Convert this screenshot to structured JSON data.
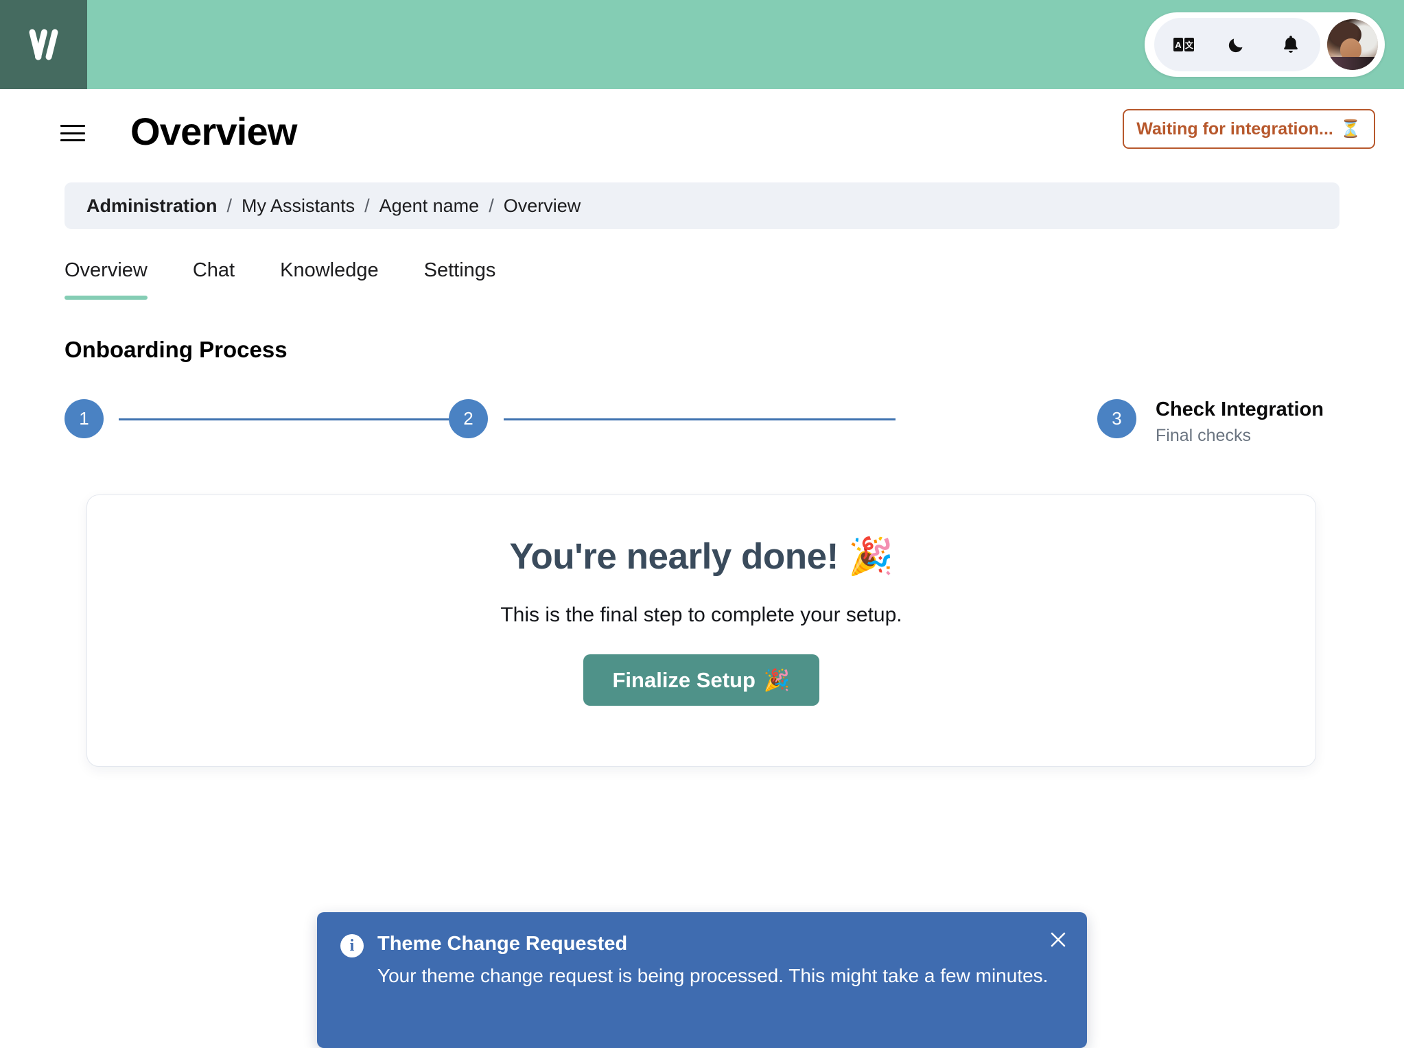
{
  "colors": {
    "brand_green": "#84cdb4",
    "logo_tile": "#456b60",
    "step_blue": "#4a82c3",
    "step_line": "#3f72b0",
    "badge_orange": "#b7582c",
    "button_teal": "#4f9289",
    "toast_blue": "#3f6cb0",
    "card_heading": "#3a4b5c",
    "breadcrumb_bg": "#eef1f6"
  },
  "header": {
    "logo_name": "app-logo",
    "icons": [
      {
        "name": "translate-icon",
        "glyph": "🔤"
      },
      {
        "name": "dark-mode-moon-icon",
        "glyph": "🌙"
      },
      {
        "name": "notifications-bell-icon",
        "glyph": "🔔"
      }
    ],
    "avatar_name": "user-avatar"
  },
  "titlebar": {
    "menu_icon": "hamburger-menu-icon",
    "title": "Overview",
    "status_badge": {
      "label": "Waiting for integration...",
      "emoji": "⏳"
    }
  },
  "breadcrumb": {
    "items": [
      {
        "label": "Administration",
        "current": false
      },
      {
        "label": "My Assistants",
        "current": false
      },
      {
        "label": "Agent name",
        "current": false
      },
      {
        "label": "Overview",
        "current": true
      }
    ],
    "separator": "/"
  },
  "tabs": [
    {
      "label": "Overview",
      "active": true
    },
    {
      "label": "Chat",
      "active": false
    },
    {
      "label": "Knowledge",
      "active": false
    },
    {
      "label": "Settings",
      "active": false
    }
  ],
  "onboarding": {
    "heading": "Onboarding Process",
    "steps": [
      {
        "number": "1",
        "label": "",
        "sublabel": ""
      },
      {
        "number": "2",
        "label": "",
        "sublabel": ""
      },
      {
        "number": "3",
        "label": "Check Integration",
        "sublabel": "Final checks"
      }
    ]
  },
  "card": {
    "title": "You're nearly done! 🎉",
    "subtitle": "This is the final step to complete your setup.",
    "button_label": "Finalize Setup",
    "button_emoji": "🎉"
  },
  "toast": {
    "icon_name": "info-circle-icon",
    "icon_glyph": "i",
    "title": "Theme Change Requested",
    "body": "Your theme change request is being processed. This might take a few minutes.",
    "close_icon": "close-icon"
  }
}
